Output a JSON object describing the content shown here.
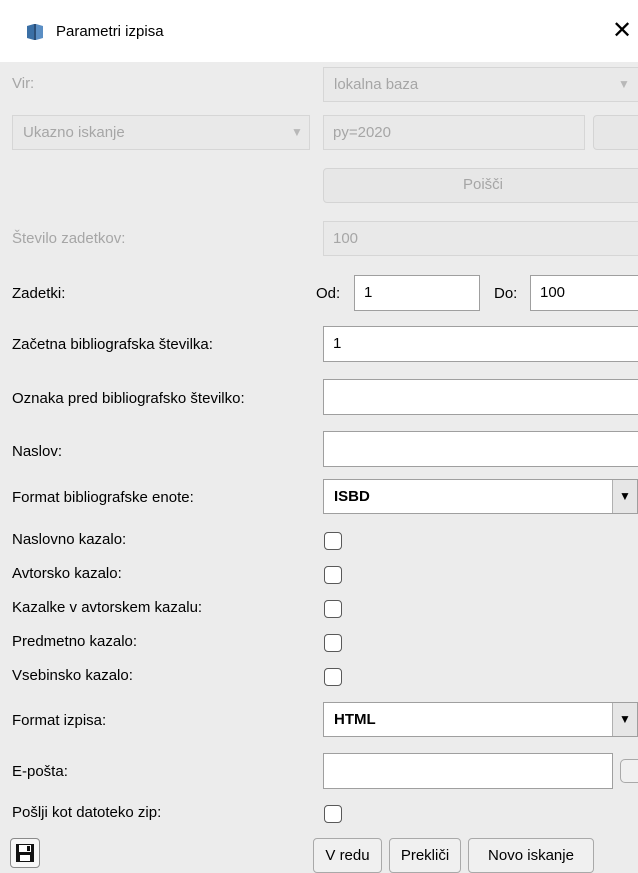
{
  "window": {
    "title": "Parametri izpisa",
    "close_glyph": "✕"
  },
  "form": {
    "source": {
      "label": "Vir:",
      "value": "lokalna baza"
    },
    "search_type": {
      "value": "Ukazno iskanje"
    },
    "query": {
      "value": "py=2020"
    },
    "search_button": {
      "label": "Poišči"
    },
    "hit_count": {
      "label": "Število zadetkov:",
      "value": "100"
    },
    "hits": {
      "label": "Zadetki:",
      "from_label": "Od:",
      "from_value": "1",
      "to_label": "Do:",
      "to_value": "100"
    },
    "start_number": {
      "label": "Začetna bibliografska številka:",
      "value": "1"
    },
    "prefix": {
      "label": "Oznaka pred bibliografsko številko:",
      "value": ""
    },
    "title_field": {
      "label": "Naslov:",
      "value": ""
    },
    "record_format": {
      "label": "Format bibliografske enote:",
      "value": "ISBD"
    },
    "checkboxes": {
      "title_index": "Naslovno kazalo:",
      "author_index": "Avtorsko kazalo:",
      "author_refs": "Kazalke v avtorskem kazalu:",
      "subject_index": "Predmetno kazalo:",
      "content_index": "Vsebinsko kazalo:"
    },
    "output_format": {
      "label": "Format izpisa:",
      "value": "HTML"
    },
    "email": {
      "label": "E-pošta:",
      "value": ""
    },
    "zip": {
      "label": "Pošlji kot datoteko zip:"
    }
  },
  "buttons": {
    "ok": "V redu",
    "cancel": "Prekliči",
    "new_search": "Novo iskanje"
  },
  "icons": {
    "app": "app-icon",
    "save": "save-icon",
    "dropdown": "▼"
  },
  "colors": {
    "disabled_text": "#a6a6a6",
    "dialog_bg": "#ececec"
  }
}
